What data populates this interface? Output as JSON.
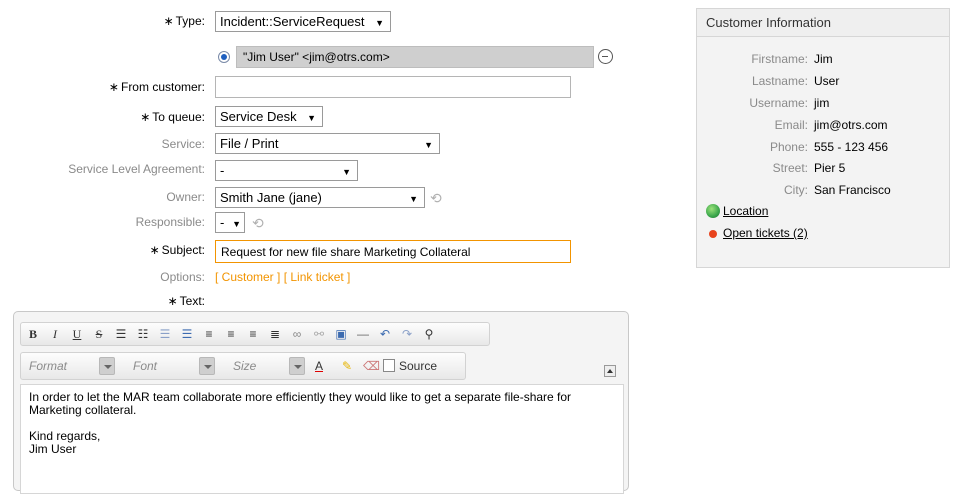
{
  "form": {
    "type_label": "Type:",
    "type_value": "Incident::ServiceRequest",
    "customer_chip": "\"Jim User\" <jim@otrs.com>",
    "from_customer_label": "From customer:",
    "from_customer_value": "",
    "to_queue_label": "To queue:",
    "to_queue_value": "Service Desk",
    "service_label": "Service:",
    "service_value": "File / Print",
    "sla_label": "Service Level Agreement:",
    "sla_value": "-",
    "owner_label": "Owner:",
    "owner_value": "Smith Jane (jane)",
    "responsible_label": "Responsible:",
    "responsible_value": "-",
    "subject_label": "Subject:",
    "subject_value": "Request for new file share Marketing Collateral",
    "options_label": "Options:",
    "options_customer": "[ Customer ]",
    "options_link_ticket": "[ Link ticket ]",
    "text_label": "Text:",
    "required_marker": "∗"
  },
  "editor": {
    "format_label": "Format",
    "font_label": "Font",
    "size_label": "Size",
    "source_label": "Source",
    "body_line1": "In order to let the MAR team collaborate more efficiently they would like to get a separate file-share for",
    "body_line2": "Marketing collateral.",
    "body_line3": "Kind regards,",
    "body_line4": "Jim User",
    "toolbar_icons": [
      "bold-icon",
      "italic-icon",
      "underline-icon",
      "strikethrough-icon",
      "numbered-list-icon",
      "bulleted-list-icon",
      "outdent-icon",
      "indent-icon",
      "align-left-icon",
      "align-center-icon",
      "align-right-icon",
      "justify-icon",
      "link-icon",
      "unlink-icon",
      "image-icon",
      "horizontal-rule-icon",
      "undo-icon",
      "redo-icon",
      "find-icon"
    ]
  },
  "customer_info": {
    "title": "Customer Information",
    "rows": [
      {
        "key": "Firstname:",
        "value": "Jim"
      },
      {
        "key": "Lastname:",
        "value": "User"
      },
      {
        "key": "Username:",
        "value": "jim"
      },
      {
        "key": "Email:",
        "value": "jim@otrs.com"
      },
      {
        "key": "Phone:",
        "value": "555 - 123 456"
      },
      {
        "key": "Street:",
        "value": "Pier 5"
      },
      {
        "key": "City:",
        "value": "San Francisco"
      }
    ],
    "location_link": "Location",
    "open_tickets_link": "Open tickets (2)"
  },
  "colors": {
    "option_link": "#f29400",
    "subject_border": "#f29400",
    "chip_bg": "#cfcfcf",
    "open_tickets_dot": "#e8431c",
    "location_globe": "#3aa64b"
  }
}
